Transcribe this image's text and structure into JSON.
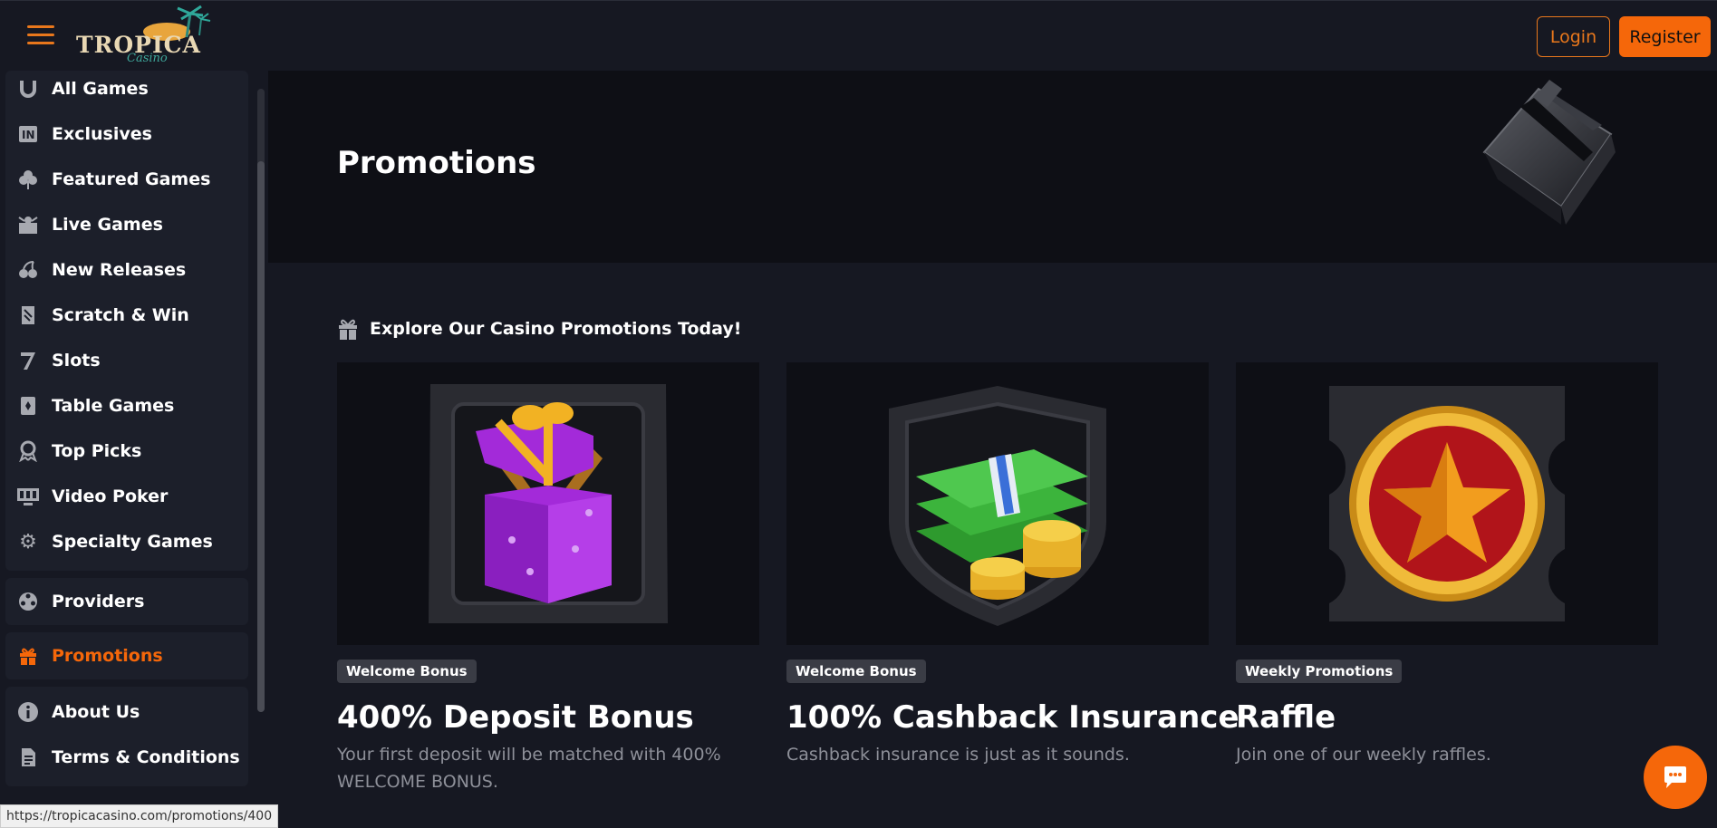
{
  "header": {
    "logo_text": "TROPICA",
    "logo_sub": "Casino",
    "login_label": "Login",
    "register_label": "Register"
  },
  "sidebar": {
    "games": [
      {
        "label": "All Games",
        "icon": "horseshoe-icon"
      },
      {
        "label": "Exclusives",
        "icon": "in-icon"
      },
      {
        "label": "Featured Games",
        "icon": "clover-icon"
      },
      {
        "label": "Live Games",
        "icon": "dealer-icon"
      },
      {
        "label": "New Releases",
        "icon": "cherry-icon"
      },
      {
        "label": "Scratch & Win",
        "icon": "ticket-icon"
      },
      {
        "label": "Slots",
        "icon": "seven-icon"
      },
      {
        "label": "Table Games",
        "icon": "card-icon"
      },
      {
        "label": "Top Picks",
        "icon": "award-icon"
      },
      {
        "label": "Video Poker",
        "icon": "monitor-icon"
      },
      {
        "label": "Specialty Games",
        "icon": "gear-icon"
      }
    ],
    "providers": {
      "label": "Providers",
      "icon": "reel-icon"
    },
    "promotions": {
      "label": "Promotions",
      "icon": "gift-icon"
    },
    "info": [
      {
        "label": "About Us",
        "icon": "info-icon"
      },
      {
        "label": "Terms & Conditions",
        "icon": "document-icon"
      }
    ]
  },
  "banner": {
    "title": "Promotions"
  },
  "main": {
    "explore_heading": "Explore Our Casino Promotions Today!",
    "cards": [
      {
        "tag": "Welcome Bonus",
        "title": "400% Deposit Bonus",
        "desc": "Your first deposit will be matched with 400% WELCOME BONUS."
      },
      {
        "tag": "Welcome Bonus",
        "title": "100% Cashback Insurance",
        "desc": "Cashback insurance is just as it sounds."
      },
      {
        "tag": "Weekly Promotions",
        "title": "Raffle",
        "desc": "Join one of our weekly raffles."
      }
    ]
  },
  "statusbar": {
    "url": "https://tropicacasino.com/promotions/400"
  },
  "colors": {
    "accent": "#f5670a",
    "background": "#161822",
    "panel": "#1c1f2a"
  }
}
